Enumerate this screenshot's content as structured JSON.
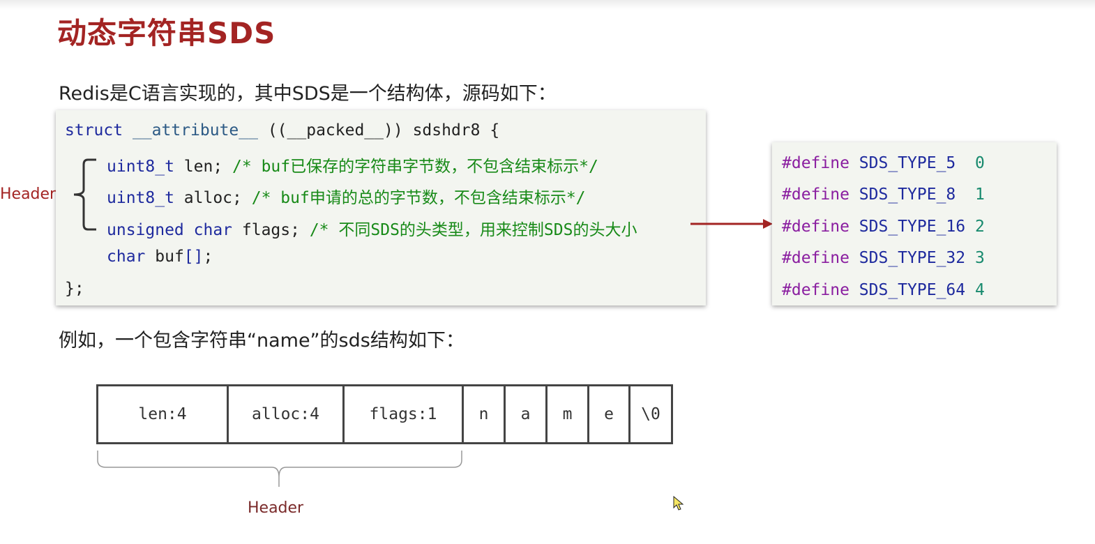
{
  "title": "动态字符串SDS",
  "intro": "Redis是C语言实现的，其中SDS是一个结构体，源码如下：",
  "code": {
    "line1": {
      "keyword": "struct",
      "attribute": "__attribute__",
      "packed": "((__packed__))",
      "name": "sdshdr8 {"
    },
    "line2": {
      "type": "uint8_t",
      "field": "len;",
      "comment": "/* buf已保存的字符串字节数，不包含结束标示*/"
    },
    "line3": {
      "type": "uint8_t",
      "field": "alloc;",
      "comment": "/* buf申请的总的字节数，不包含结束标示*/"
    },
    "line4": {
      "type": "unsigned char",
      "field": "flags;",
      "comment": "/* 不同SDS的头类型，用来控制SDS的头大小"
    },
    "line5": {
      "type": "char",
      "field": "buf",
      "brackets": "[]",
      "end": ";"
    },
    "line6": "};"
  },
  "header_label_left": "Header",
  "defines": [
    {
      "keyword": "#define",
      "name": "SDS_TYPE_5 ",
      "value": "0"
    },
    {
      "keyword": "#define",
      "name": "SDS_TYPE_8 ",
      "value": "1"
    },
    {
      "keyword": "#define",
      "name": "SDS_TYPE_16",
      "value": "2"
    },
    {
      "keyword": "#define",
      "name": "SDS_TYPE_32",
      "value": "3"
    },
    {
      "keyword": "#define",
      "name": "SDS_TYPE_64",
      "value": "4"
    }
  ],
  "example_text": "例如，一个包含字符串“name”的sds结构如下：",
  "cells": [
    "len:4",
    "alloc:4",
    "flags:1",
    "n",
    "a",
    "m",
    "e",
    "\\0"
  ],
  "header_label_bottom": "Header",
  "colors": {
    "title": "#a32423",
    "keyword": "#1e2a9e",
    "comment": "#188a18",
    "define": "#8a1ea0",
    "arrow": "#a32423"
  }
}
